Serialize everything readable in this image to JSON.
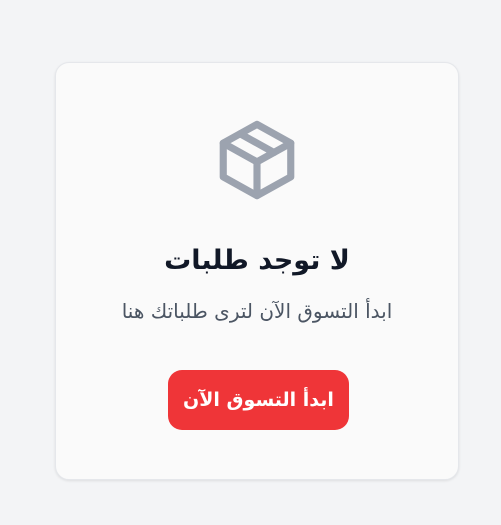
{
  "empty_state": {
    "icon": "box-icon",
    "title": "لا توجد طلبات",
    "message": "ابدأ التسوق الآن لترى طلباتك هنا",
    "cta_label": "ابدأ التسوق الآن"
  },
  "colors": {
    "background": "#f3f4f6",
    "card": "#fafafa",
    "icon": "#9ca3af",
    "title": "#111827",
    "message": "#4b5563",
    "button": "#ef3538",
    "button_text": "#ffffff"
  }
}
